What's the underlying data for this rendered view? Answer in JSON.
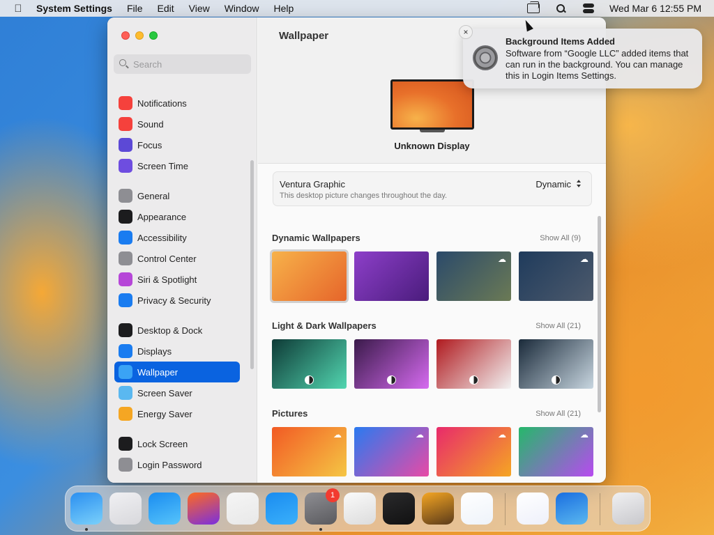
{
  "menubar": {
    "apple_icon": "apple-icon",
    "app_name": "System Settings",
    "menus": [
      "File",
      "Edit",
      "View",
      "Window",
      "Help"
    ],
    "clock": "Wed Mar 6  12:55 PM"
  },
  "sidebar": {
    "search_placeholder": "Search",
    "groups": [
      [
        {
          "label": "Notifications",
          "icon": "bell-icon",
          "color": "#f5413c"
        },
        {
          "label": "Sound",
          "icon": "speaker-icon",
          "color": "#f5413c"
        },
        {
          "label": "Focus",
          "icon": "moon-icon",
          "color": "#5c49d6"
        },
        {
          "label": "Screen Time",
          "icon": "hourglass-icon",
          "color": "#6e4de0"
        }
      ],
      [
        {
          "label": "General",
          "icon": "gear-icon",
          "color": "#8e8e93"
        },
        {
          "label": "Appearance",
          "icon": "appearance-icon",
          "color": "#1c1c1e"
        },
        {
          "label": "Accessibility",
          "icon": "accessibility-icon",
          "color": "#1a7cf0"
        },
        {
          "label": "Control Center",
          "icon": "control-center-icon",
          "color": "#8e8e93"
        },
        {
          "label": "Siri & Spotlight",
          "icon": "siri-icon",
          "color": "#b646d8"
        },
        {
          "label": "Privacy & Security",
          "icon": "hand-icon",
          "color": "#1a7cf0"
        }
      ],
      [
        {
          "label": "Desktop & Dock",
          "icon": "dock-icon",
          "color": "#1c1c1e"
        },
        {
          "label": "Displays",
          "icon": "sun-icon",
          "color": "#1a7cf0"
        },
        {
          "label": "Wallpaper",
          "icon": "wallpaper-icon",
          "color": "#3aa3f5",
          "selected": true
        },
        {
          "label": "Screen Saver",
          "icon": "screen-saver-icon",
          "color": "#5ab8f0"
        },
        {
          "label": "Energy Saver",
          "icon": "battery-icon",
          "color": "#f5a623"
        }
      ],
      [
        {
          "label": "Lock Screen",
          "icon": "lock-icon",
          "color": "#1c1c1e"
        },
        {
          "label": "Login Password",
          "icon": "lock-icon",
          "color": "#8e8e93"
        }
      ]
    ]
  },
  "main": {
    "title": "Wallpaper",
    "display_name": "Unknown Display",
    "current": {
      "name": "Ventura Graphic",
      "description": "This desktop picture changes throughout the day.",
      "mode": "Dynamic"
    },
    "sections": [
      {
        "title": "Dynamic Wallpapers",
        "show_all": "Show All (9)",
        "thumbs": [
          {
            "colors": [
              "#f7b24a",
              "#e6652a"
            ],
            "selected": true,
            "cloud": false,
            "light_dark": false
          },
          {
            "colors": [
              "#8d3fc9",
              "#4a1c7c"
            ],
            "selected": false,
            "cloud": false,
            "light_dark": false
          },
          {
            "colors": [
              "#2b4a6a",
              "#6b7a55"
            ],
            "selected": false,
            "cloud": true,
            "light_dark": false
          },
          {
            "colors": [
              "#1f3b5c",
              "#4d5a6c"
            ],
            "selected": false,
            "cloud": true,
            "light_dark": false
          }
        ]
      },
      {
        "title": "Light & Dark Wallpapers",
        "show_all": "Show All (21)",
        "thumbs": [
          {
            "colors": [
              "#0e3a36",
              "#52d6b0"
            ],
            "selected": false,
            "cloud": false,
            "light_dark": true
          },
          {
            "colors": [
              "#3a1a4a",
              "#d66bf0"
            ],
            "selected": false,
            "cloud": false,
            "light_dark": true
          },
          {
            "colors": [
              "#b01a1f",
              "#f2f2f2"
            ],
            "selected": false,
            "cloud": false,
            "light_dark": true
          },
          {
            "colors": [
              "#1a2a3a",
              "#c8d6e0"
            ],
            "selected": false,
            "cloud": false,
            "light_dark": true
          }
        ]
      },
      {
        "title": "Pictures",
        "show_all": "Show All (21)",
        "thumbs": [
          {
            "colors": [
              "#f25a24",
              "#f5c644"
            ],
            "selected": false,
            "cloud": true,
            "light_dark": false
          },
          {
            "colors": [
              "#2a7af0",
              "#e84aa6"
            ],
            "selected": false,
            "cloud": true,
            "light_dark": false
          },
          {
            "colors": [
              "#e82a6b",
              "#f5a623"
            ],
            "selected": false,
            "cloud": true,
            "light_dark": false
          },
          {
            "colors": [
              "#25b86a",
              "#b84af0"
            ],
            "selected": false,
            "cloud": true,
            "light_dark": false
          }
        ]
      }
    ]
  },
  "notification": {
    "title": "Background Items Added",
    "body": "Software from “Google LLC” added items that can run in the background. You can manage this in Login Items Settings.",
    "close_glyph": "×",
    "icon": "system-settings-icon"
  },
  "dock": {
    "apps": [
      {
        "name": "finder-icon",
        "colors": [
          "#2b8ff0",
          "#7ad0fb"
        ],
        "running": true
      },
      {
        "name": "launchpad-icon",
        "colors": [
          "#f0f0f3",
          "#d8d8dc"
        ],
        "running": false
      },
      {
        "name": "safari-icon",
        "colors": [
          "#1a8cf0",
          "#56c4fb"
        ],
        "running": false
      },
      {
        "name": "firefox-icon",
        "colors": [
          "#ff6a1f",
          "#7a2fe0"
        ],
        "running": false
      },
      {
        "name": "chrome-icon",
        "colors": [
          "#f5f5f5",
          "#e8e8e8"
        ],
        "running": false
      },
      {
        "name": "app-store-icon",
        "colors": [
          "#1a8cf0",
          "#3ab0fb"
        ],
        "running": false
      },
      {
        "name": "system-settings-icon",
        "colors": [
          "#8e8e93",
          "#5a5a5e"
        ],
        "running": true
      },
      {
        "name": "textedit-icon",
        "colors": [
          "#fafafa",
          "#dcdcdc"
        ],
        "running": false
      },
      {
        "name": "terminal-icon",
        "colors": [
          "#2a2a2c",
          "#111111"
        ],
        "running": false
      },
      {
        "name": "garageband-icon",
        "colors": [
          "#f5a623",
          "#5a3a1a"
        ],
        "running": false
      },
      {
        "name": "vscode-icon",
        "colors": [
          "#ffffff",
          "#eef3fa"
        ],
        "running": false
      }
    ],
    "apps_right": [
      {
        "name": "visual-studio-icon",
        "colors": [
          "#ffffff",
          "#eef0fa"
        ],
        "running": false
      },
      {
        "name": "weather-icon",
        "colors": [
          "#1a6ee0",
          "#5ab8f0"
        ],
        "running": false
      }
    ],
    "trash": {
      "name": "trash-icon",
      "colors": [
        "#f0f0f2",
        "#c8c8cc"
      ]
    },
    "badge": "1"
  }
}
